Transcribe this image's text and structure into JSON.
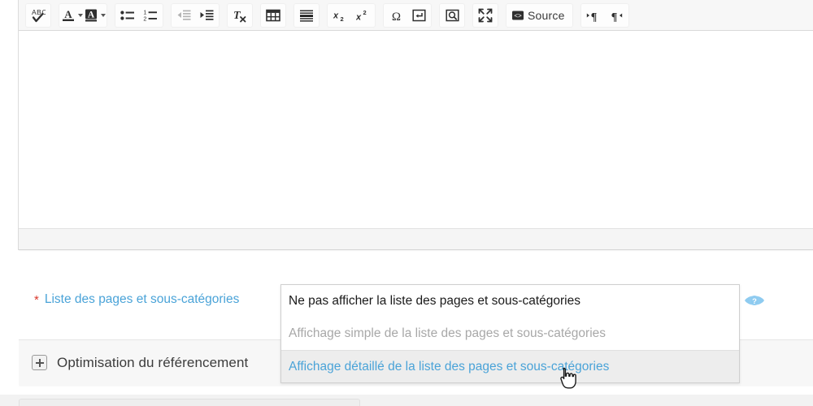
{
  "editor": {
    "toolbar_groups": [
      {
        "name": "spellcheck-group",
        "buttons": [
          {
            "name": "spell-check-button",
            "icon": "abc-check-icon",
            "label": "",
            "disabled": false,
            "dropdown": false
          }
        ]
      },
      {
        "name": "color-group",
        "buttons": [
          {
            "name": "text-color-button",
            "icon": "text-color-icon",
            "label": "",
            "disabled": false,
            "dropdown": true
          },
          {
            "name": "background-color-button",
            "icon": "background-color-icon",
            "label": "",
            "disabled": false,
            "dropdown": true
          }
        ]
      },
      {
        "name": "list-group",
        "buttons": [
          {
            "name": "bulleted-list-button",
            "icon": "bulleted-list-icon",
            "label": "",
            "disabled": false,
            "dropdown": false
          },
          {
            "name": "numbered-list-button",
            "icon": "numbered-list-icon",
            "label": "",
            "disabled": false,
            "dropdown": false
          }
        ]
      },
      {
        "name": "indent-group",
        "buttons": [
          {
            "name": "decrease-indent-button",
            "icon": "outdent-icon",
            "label": "",
            "disabled": true,
            "dropdown": false
          },
          {
            "name": "increase-indent-button",
            "icon": "indent-icon",
            "label": "",
            "disabled": false,
            "dropdown": false
          }
        ]
      },
      {
        "name": "remove-format-group",
        "buttons": [
          {
            "name": "remove-format-button",
            "icon": "remove-format-icon",
            "label": "",
            "disabled": false,
            "dropdown": false
          }
        ]
      },
      {
        "name": "table-group",
        "buttons": [
          {
            "name": "insert-table-button",
            "icon": "table-icon",
            "label": "",
            "disabled": false,
            "dropdown": false
          }
        ]
      },
      {
        "name": "horizontal-rule-group",
        "buttons": [
          {
            "name": "horizontal-rule-button",
            "icon": "horizontal-rule-icon",
            "label": "",
            "disabled": false,
            "dropdown": false
          }
        ]
      },
      {
        "name": "script-group",
        "buttons": [
          {
            "name": "subscript-button",
            "icon": "subscript-icon",
            "label": "",
            "disabled": false,
            "dropdown": false
          },
          {
            "name": "superscript-button",
            "icon": "superscript-icon",
            "label": "",
            "disabled": false,
            "dropdown": false
          }
        ]
      },
      {
        "name": "insert-group",
        "buttons": [
          {
            "name": "special-character-button",
            "icon": "omega-icon",
            "label": "",
            "disabled": false,
            "dropdown": false
          },
          {
            "name": "page-break-button",
            "icon": "page-break-icon",
            "label": "",
            "disabled": false,
            "dropdown": false
          }
        ]
      },
      {
        "name": "preview-group",
        "buttons": [
          {
            "name": "preview-button",
            "icon": "preview-magnifier-icon",
            "label": "",
            "disabled": false,
            "dropdown": false
          }
        ]
      },
      {
        "name": "maximize-group",
        "buttons": [
          {
            "name": "maximize-button",
            "icon": "maximize-arrows-icon",
            "label": "",
            "disabled": false,
            "dropdown": false
          }
        ]
      },
      {
        "name": "source-group",
        "buttons": [
          {
            "name": "source-button",
            "icon": "source-code-icon",
            "label": "Source",
            "disabled": false,
            "dropdown": false
          }
        ]
      },
      {
        "name": "text-direction-group",
        "buttons": [
          {
            "name": "text-direction-ltr-button",
            "icon": "paragraph-ltr-icon",
            "label": "",
            "disabled": false,
            "dropdown": false
          },
          {
            "name": "text-direction-rtl-button",
            "icon": "paragraph-rtl-icon",
            "label": "",
            "disabled": false,
            "dropdown": false
          }
        ]
      }
    ],
    "content": "",
    "footer_text": ""
  },
  "field": {
    "required_marker": "*",
    "label": "Liste des pages et sous-catégories",
    "help_icon": "help-eye-icon",
    "select": {
      "selected_value": "Ne pas afficher la liste des pages et sous-catégories",
      "options": [
        {
          "label": "Ne pas afficher la liste des pages et sous-catégories",
          "state": "selected"
        },
        {
          "label": "Affichage simple de la liste des pages et sous-catégories",
          "state": "normal"
        },
        {
          "label": "Affichage détaillé de la liste des pages et sous-catégories",
          "state": "highlighted"
        }
      ]
    }
  },
  "seo_panel": {
    "toggle_icon": "plus-box-icon",
    "title": "Optimisation du référencement",
    "expanded": false
  },
  "colors": {
    "link_blue": "#4aa3d8",
    "required_red": "#d9372b",
    "highlight_bg": "#ededed",
    "toolbar_bg": "#f7f7f7",
    "panel_bg": "#f7f7f7"
  },
  "cursor": {
    "type": "pointer-hand-cursor"
  }
}
